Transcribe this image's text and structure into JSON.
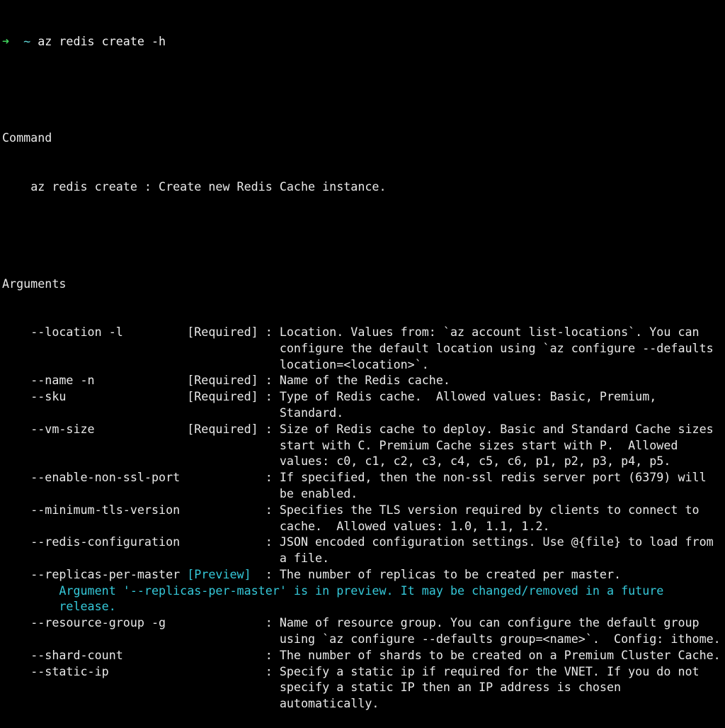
{
  "prompt": {
    "arrow": "➜",
    "tilde": "~",
    "command": "az redis create -h"
  },
  "sections": {
    "command_heading": "Command",
    "command_desc": "az redis create : Create new Redis Cache instance.",
    "arguments_heading": "Arguments"
  },
  "arguments": [
    {
      "name": "--location -l",
      "tag": "[Required]",
      "desc": [
        "Location. Values from: `az account list-locations`. You can",
        "configure the default location using `az configure --defaults",
        "location=<location>`."
      ]
    },
    {
      "name": "--name -n",
      "tag": "[Required]",
      "desc": [
        "Name of the Redis cache."
      ]
    },
    {
      "name": "--sku",
      "tag": "[Required]",
      "desc": [
        "Type of Redis cache.  Allowed values: Basic, Premium,",
        "Standard."
      ]
    },
    {
      "name": "--vm-size",
      "tag": "[Required]",
      "desc": [
        "Size of Redis cache to deploy. Basic and Standard Cache sizes",
        "start with C. Premium Cache sizes start with P.  Allowed",
        "values: c0, c1, c2, c3, c4, c5, c6, p1, p2, p3, p4, p5."
      ]
    },
    {
      "name": "--enable-non-ssl-port",
      "tag": "",
      "desc": [
        "If specified, then the non-ssl redis server port (6379) will",
        "be enabled."
      ]
    },
    {
      "name": "--minimum-tls-version",
      "tag": "",
      "desc": [
        "Specifies the TLS version required by clients to connect to",
        "cache.  Allowed values: 1.0, 1.1, 1.2."
      ]
    },
    {
      "name": "--redis-configuration",
      "tag": "",
      "desc": [
        "JSON encoded configuration settings. Use @{file} to load from",
        "a file."
      ]
    },
    {
      "name": "--replicas-per-master",
      "tag": "[Preview]",
      "desc": [
        "The number of replicas to be created per master."
      ],
      "note": [
        "Argument '--replicas-per-master' is in preview. It may be changed/removed in a future",
        "release."
      ]
    },
    {
      "name": "--resource-group -g",
      "tag": "",
      "desc": [
        "Name of resource group. You can configure the default group",
        "using `az configure --defaults group=<name>`.  Config: ithome."
      ]
    },
    {
      "name": "--shard-count",
      "tag": "",
      "desc": [
        "The number of shards to be created on a Premium Cluster Cache."
      ]
    },
    {
      "name": "--static-ip",
      "tag": "",
      "desc": [
        "Specify a static ip if required for the VNET. If you do not",
        "specify a static IP then an IP address is chosen",
        "automatically."
      ]
    }
  ],
  "colors": {
    "background": "#000000",
    "text": "#e9e9e9",
    "prompt_arrow": "#3fd15b",
    "prompt_tilde": "#5fd7d7",
    "preview": "#35c8d9"
  }
}
